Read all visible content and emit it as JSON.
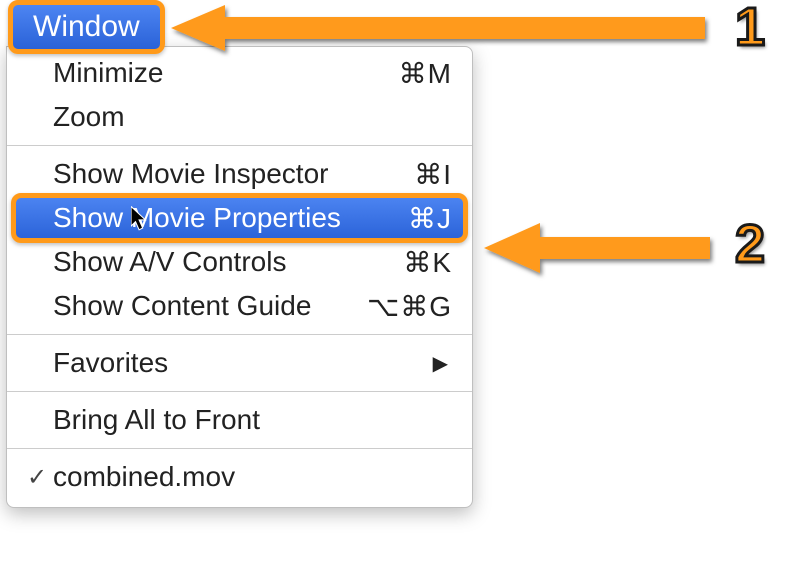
{
  "menu_title": "Window",
  "menu": {
    "groups": [
      [
        {
          "label": "Minimize",
          "shortcut": "⌘M"
        },
        {
          "label": "Zoom",
          "shortcut": ""
        }
      ],
      [
        {
          "label": "Show Movie Inspector",
          "shortcut": "⌘I"
        },
        {
          "label": "Show Movie Properties",
          "shortcut": "⌘J",
          "highlighted": true
        },
        {
          "label": "Show A/V Controls",
          "shortcut": "⌘K"
        },
        {
          "label": "Show Content Guide",
          "shortcut": "⌥⌘G"
        }
      ],
      [
        {
          "label": "Favorites",
          "submenu": true
        }
      ],
      [
        {
          "label": "Bring All to Front"
        }
      ],
      [
        {
          "label": "combined.mov",
          "checked": true
        }
      ]
    ]
  },
  "annotations": {
    "badge1": "1",
    "badge2": "2"
  }
}
